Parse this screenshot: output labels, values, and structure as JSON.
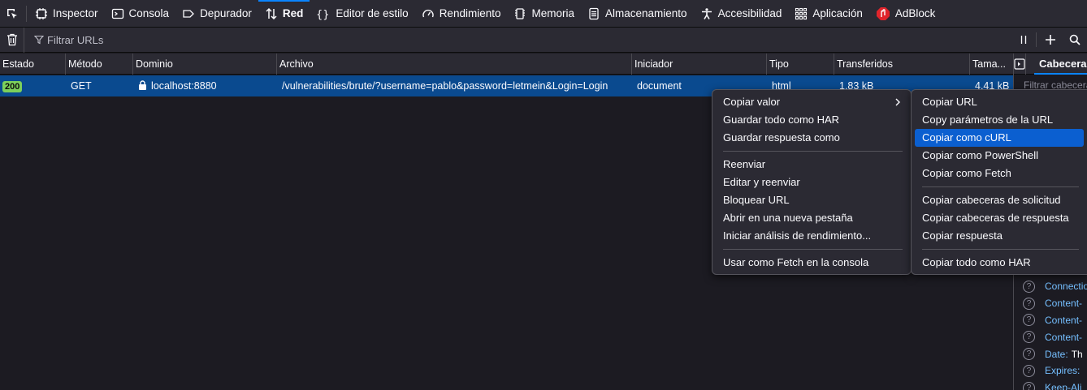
{
  "toolbar": {
    "tabs": [
      {
        "label": "Inspector",
        "icon": "inspector-icon"
      },
      {
        "label": "Consola",
        "icon": "console-icon"
      },
      {
        "label": "Depurador",
        "icon": "debugger-icon"
      },
      {
        "label": "Red",
        "icon": "network-icon",
        "active": true
      },
      {
        "label": "Editor de estilo",
        "icon": "style-editor-icon"
      },
      {
        "label": "Rendimiento",
        "icon": "performance-icon"
      },
      {
        "label": "Memoria",
        "icon": "memory-icon"
      },
      {
        "label": "Almacenamiento",
        "icon": "storage-icon"
      },
      {
        "label": "Accesibilidad",
        "icon": "accessibility-icon"
      },
      {
        "label": "Aplicación",
        "icon": "application-icon"
      },
      {
        "label": "AdBlock",
        "icon": "adblock-icon"
      }
    ]
  },
  "filterbar": {
    "placeholder": "Filtrar URLs"
  },
  "table": {
    "columns": [
      "Estado",
      "Método",
      "Dominio",
      "Archivo",
      "Iniciador",
      "Tipo",
      "Transferidos",
      "Tama..."
    ],
    "row": {
      "status": "200",
      "method": "GET",
      "domain": "localhost:8880",
      "file": "/vulnerabilities/brute/?username=pablo&password=letmein&Login=Login",
      "initiator": "document",
      "type": "html",
      "transferred": "1,83 kB",
      "size": "4,41 kB"
    }
  },
  "sidepanel": {
    "tab": "Cabeceras",
    "filter_placeholder": "Filtrar cabeceras",
    "headers": [
      {
        "name": "Connection",
        "value": ""
      },
      {
        "name": "Content-",
        "value": ""
      },
      {
        "name": "Content-",
        "value": ""
      },
      {
        "name": "Content-",
        "value": ""
      },
      {
        "name": "Date:",
        "value": "Th"
      },
      {
        "name": "Expires:",
        "value": ""
      },
      {
        "name": "Keep-Ali",
        "value": ""
      }
    ]
  },
  "context_menu": {
    "copy_value": "Copiar valor",
    "save_all_har": "Guardar todo como HAR",
    "save_response": "Guardar respuesta como",
    "resend": "Reenviar",
    "edit_resend": "Editar y reenviar",
    "block_url": "Bloquear URL",
    "open_new_tab": "Abrir en una nueva pestaña",
    "start_perf": "Iniciar análisis de rendimiento...",
    "use_fetch_console": "Usar como Fetch en la consola"
  },
  "submenu": {
    "copy_url": "Copiar URL",
    "copy_url_params": "Copy parámetros de la URL",
    "copy_curl": "Copiar como cURL",
    "copy_powershell": "Copiar como PowerShell",
    "copy_fetch": "Copiar como Fetch",
    "copy_req_headers": "Copiar cabeceras de solicitud",
    "copy_resp_headers": "Copiar cabeceras de respuesta",
    "copy_response": "Copiar respuesta",
    "copy_all_har": "Copiar todo como HAR"
  },
  "colors": {
    "accent": "#0a84ff",
    "selected_row": "#0a4a8f",
    "menu_highlight": "#0b5fd0",
    "status_ok": "#7cd05b",
    "adblock": "#e0242b"
  }
}
